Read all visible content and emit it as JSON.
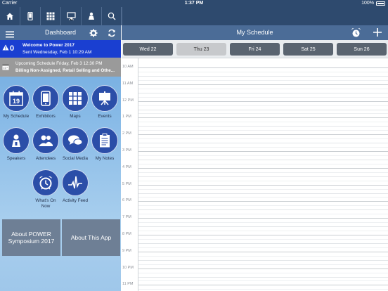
{
  "status_bar": {
    "carrier": "Carrier",
    "time": "1:37 PM",
    "battery": "100%"
  },
  "toolbar": {
    "icons": [
      "home-icon",
      "device-icon",
      "grid-icon",
      "presentation-icon",
      "speaker-icon",
      "search-icon"
    ]
  },
  "left_panel": {
    "title": "Dashboard",
    "alert": {
      "count": "0",
      "title": "Welcome to Power 2017",
      "sent": "Sent Wednesday, Feb 1 10:29 AM"
    },
    "upcoming": {
      "line1": "Upcoming Schedule Friday, Feb 3 12:30 PM",
      "line2": "Billing Non-Assigned, Retail Selling and Othe..."
    },
    "tiles": [
      {
        "label": "My Schedule",
        "icon": "calendar-icon",
        "badge": "19"
      },
      {
        "label": "Exhibitors",
        "icon": "phone-icon"
      },
      {
        "label": "Maps",
        "icon": "map-grid-icon"
      },
      {
        "label": "Events",
        "icon": "easel-icon"
      },
      {
        "label": "Speakers",
        "icon": "speaker-person-icon"
      },
      {
        "label": "Attendees",
        "icon": "people-icon"
      },
      {
        "label": "Social Media",
        "icon": "chat-bubbles-icon"
      },
      {
        "label": "My Notes",
        "icon": "clipboard-icon"
      },
      {
        "label": "What's On Now",
        "icon": "alarm-clock-icon"
      },
      {
        "label": "Activity Feed",
        "icon": "pulse-icon"
      }
    ],
    "about_power": "About POWER Symposium 2017",
    "about_app": "About This App"
  },
  "right_panel": {
    "title": "My Schedule",
    "days": [
      {
        "label": "Wed 22",
        "selected": false
      },
      {
        "label": "Thu 23",
        "selected": true
      },
      {
        "label": "Fri 24",
        "selected": false
      },
      {
        "label": "Sat 25",
        "selected": false
      },
      {
        "label": "Sun 26",
        "selected": false
      }
    ],
    "hours": [
      "10 AM",
      "11 AM",
      "12 PM",
      "1 PM",
      "2 PM",
      "3 PM",
      "4 PM",
      "5 PM",
      "6 PM",
      "7 PM",
      "8 PM",
      "9 PM",
      "10 PM",
      "11 PM"
    ]
  },
  "colors": {
    "nav_bar": "#2e4a6e",
    "header": "#4b6c97",
    "alert": "#1a3fd1",
    "tile": "#2b4ea8",
    "day_tab": "#5a6470",
    "day_tab_selected": "#c7c9cc"
  }
}
